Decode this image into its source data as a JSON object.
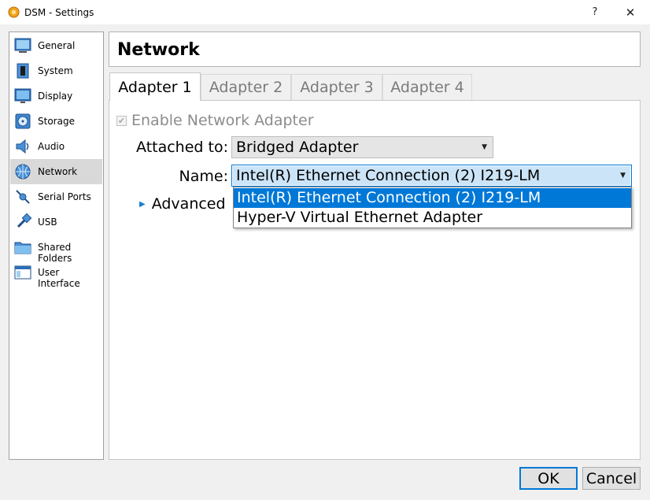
{
  "window": {
    "title": "DSM - Settings",
    "help_label": "?",
    "close_label": "✕"
  },
  "sidebar": {
    "items": [
      {
        "label": "General",
        "icon": "general-icon"
      },
      {
        "label": "System",
        "icon": "system-icon"
      },
      {
        "label": "Display",
        "icon": "display-icon"
      },
      {
        "label": "Storage",
        "icon": "storage-icon"
      },
      {
        "label": "Audio",
        "icon": "audio-icon"
      },
      {
        "label": "Network",
        "icon": "network-icon",
        "selected": true
      },
      {
        "label": "Serial Ports",
        "icon": "serial-ports-icon"
      },
      {
        "label": "USB",
        "icon": "usb-icon"
      },
      {
        "label": "Shared Folders",
        "icon": "shared-folders-icon"
      },
      {
        "label": "User Interface",
        "icon": "user-interface-icon"
      }
    ]
  },
  "header": {
    "title": "Network"
  },
  "tabs": [
    {
      "label": "Adapter 1",
      "active": true
    },
    {
      "label": "Adapter 2"
    },
    {
      "label": "Adapter 3"
    },
    {
      "label": "Adapter 4"
    }
  ],
  "adapter": {
    "enable_label": "Enable Network Adapter",
    "enable_checked": true,
    "attached_label": "Attached to:",
    "attached_value": "Bridged Adapter",
    "name_label": "Name:",
    "name_value": "Intel(R) Ethernet Connection (2) I219-LM",
    "name_options": [
      "Intel(R) Ethernet Connection (2) I219-LM",
      "Hyper-V Virtual Ethernet Adapter"
    ],
    "advanced_label": "Advanced"
  },
  "buttons": {
    "ok": "OK",
    "cancel": "Cancel"
  },
  "colors": {
    "accent": "#0078d7",
    "selection": "#cce4f7",
    "sidebar_selected": "#d9d9d9"
  }
}
